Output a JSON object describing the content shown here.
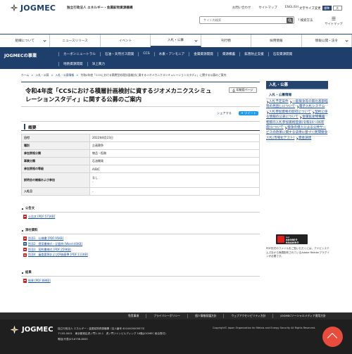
{
  "header": {
    "logo_text": "JOGMEC",
    "org_name": "独立行政法人 エネルギー・金属鉱物資源機構",
    "top_links": [
      "お問い合わせ",
      "サイトマップ",
      "ENGLISH"
    ],
    "font_size_label": "文字サイズ変更",
    "font_sizes": [
      "標準",
      "大"
    ],
    "search_placeholder": "サイト内検索",
    "search_howto": "検索方法",
    "sitemap": "サイトマップ"
  },
  "global_nav": [
    "組織について",
    "ニュースリリース",
    "イベント",
    "入札・公募",
    "刊行物",
    "採用情報",
    "情報公開・法令"
  ],
  "sec_nav": {
    "label": "JOGMECの事業",
    "row1": [
      "カーボンニュートラル",
      "石油・天然ガス開発",
      "CCS",
      "水素・アンモニア",
      "金属資源開発",
      "資源備蓄",
      "鉱害防止支援",
      "石炭資源開発"
    ],
    "row2": [
      "地熱資源開発",
      "洋上風力"
    ]
  },
  "breadcrumb": [
    "ホーム",
    "入札・公募",
    "入札・公募情報",
    "令和4年度「CCSにおける積層型処理計画検討に資するジオメカニクスシミュレーションスタディ」に関する公募のご案内"
  ],
  "page": {
    "title": "令和4年度「CCSにおける積層計画検討に資するジオメカニクスシミュレーションスタディ」に関する公募のご案内",
    "print_label": "印刷用ページ",
    "share_label": "シェアする",
    "tweet_label": "ツイート",
    "summary_heading": "概要",
    "summary_rows": [
      {
        "key": "日付",
        "value": "2022年8月23日"
      },
      {
        "key": "種別",
        "value": "企画競争"
      },
      {
        "key": "参加資格分類",
        "value": "物品・役務"
      },
      {
        "key": "事業分類",
        "value": "石油開発"
      },
      {
        "key": "参加資格の等級",
        "value": "A/B/C"
      },
      {
        "key": "説明会の開催および参加",
        "value": "なし\n-"
      },
      {
        "key": "入札日",
        "value": "-"
      }
    ],
    "sections": [
      {
        "heading": "公告文",
        "items": [
          {
            "label": "公告文 [PDF:571KB]",
            "icon": "pdf"
          }
        ]
      },
      {
        "heading": "添付資料",
        "items": [
          {
            "label": "別添1　仕様書 [PDF:95KB]",
            "icon": "pdf"
          },
          {
            "label": "別添2　提案書様式・記載例 [Word:40KB]",
            "icon": "word"
          },
          {
            "label": "別添3　契約書様式 [PDF:259KB]",
            "icon": "pdf"
          },
          {
            "label": "別添4　審査要領および評価基準 [PDF:111KB]",
            "icon": "pdf"
          }
        ]
      },
      {
        "heading": "結果",
        "items": [
          {
            "label": "結果 [PDF:88KB]",
            "icon": "pdf"
          }
        ]
      }
    ]
  },
  "side": {
    "heading": "入札・公募",
    "sub": "入札・公募情報",
    "items": [
      "入札予定案件",
      "一般競争等の無比基部経等の見直しについて",
      "電子入札システム",
      "入札参加資格の取得について",
      "契約に係る情報の公表について",
      "金属鉱産物備蓄物資の入札参加資格登録(令和04〜06年度)について",
      "競争の導入による公共サービスの改革に関する法律に基づく民間競争入札(市場化テスト)",
      "資金調達"
    ],
    "adobe_get": "Get",
    "adobe_reader": "ADOBE® READER®",
    "adobe_note": "PDF形式のファイルをご覧いただくには、アドビシステムズ社から無償配布されているAdobe Readerプラグインが必要です。"
  },
  "footer": {
    "links": [
      "免責事項",
      "プライバシーポリシー",
      "個人情報保護方針",
      "ウェブアクセシビリティ方針",
      "JOGMECソーシャルメディア運用方針"
    ],
    "logo_text": "JOGMEC",
    "address_lines": [
      "独立行政法人 エネルギー・金属鉱物資源機構（法人番号 4010405009573）",
      "〒105-0001　東京都港区虎ノ門2-10-1　虎ノ門ツインビルディング 16階(JOGMEC 総合受付)",
      "電話(代表)03-6758-8000"
    ],
    "copyright": "Copyright© Japan Organization for Metals and Energy Security All Rights Reserved."
  },
  "colors": {
    "navy": "#1e3f6b",
    "link": "#1a4fa0",
    "pdf": "#d42222",
    "totop": "#e74c3c"
  }
}
